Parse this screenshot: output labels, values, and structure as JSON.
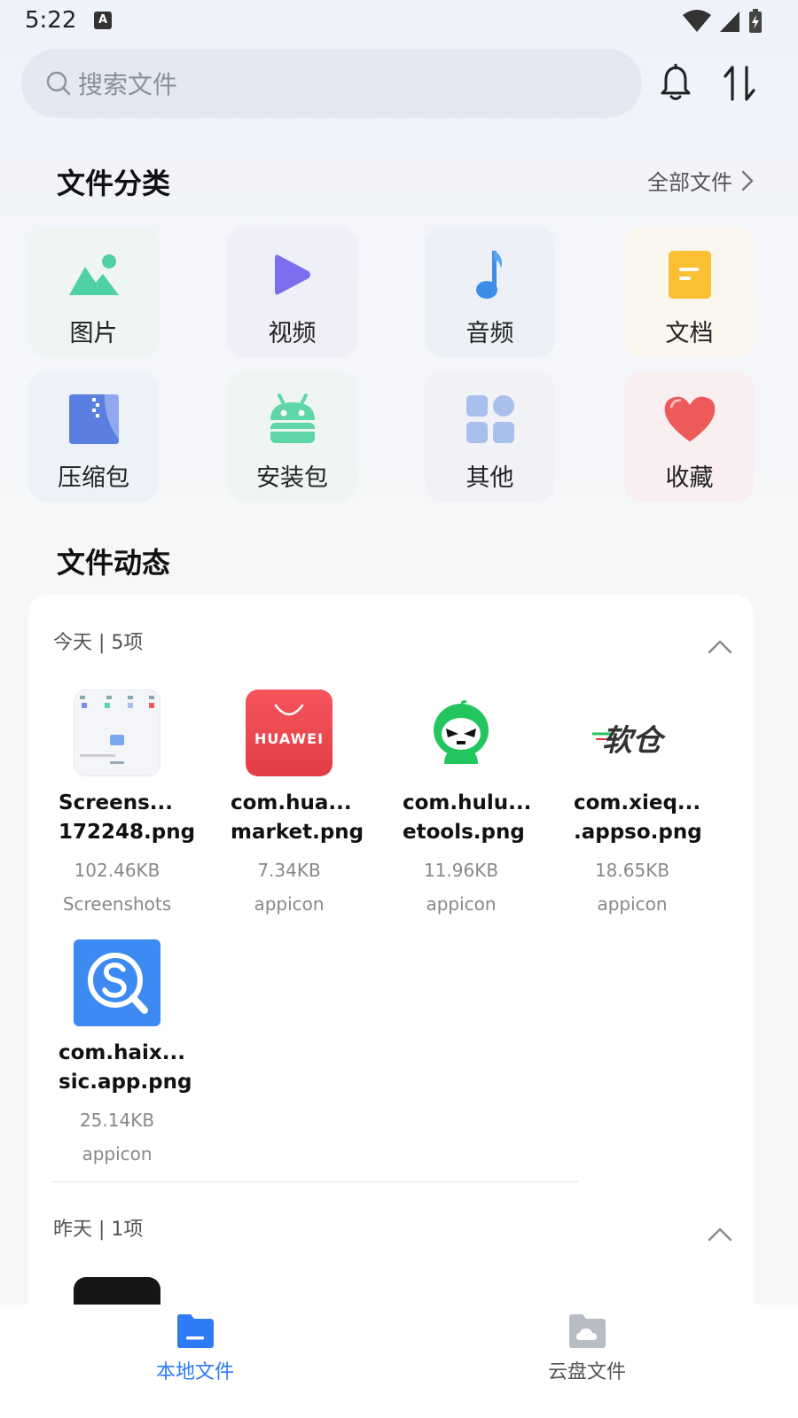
{
  "status_bar": {
    "time": "5:22",
    "a_badge": "A"
  },
  "search": {
    "placeholder": "搜索文件"
  },
  "categories_section": {
    "title": "文件分类",
    "all_files_label": "全部文件",
    "items": [
      {
        "label": "图片",
        "icon": "image-icon",
        "bg": "#eef5f3",
        "color": "#4fd1a5"
      },
      {
        "label": "视频",
        "icon": "video-play-icon",
        "bg": "#eeeff7",
        "color": "#7b6ff0"
      },
      {
        "label": "音频",
        "icon": "music-note-icon",
        "bg": "#edf0f6",
        "color": "#3c8de8"
      },
      {
        "label": "文档",
        "icon": "document-icon",
        "bg": "#faf6ee",
        "color": "#fbbf34"
      },
      {
        "label": "压缩包",
        "icon": "zip-archive-icon",
        "bg": "#edf1f8",
        "color": "#5b7fe0"
      },
      {
        "label": "安装包",
        "icon": "android-package-icon",
        "bg": "#eef5f2",
        "color": "#5fd6a8"
      },
      {
        "label": "其他",
        "icon": "other-grid-icon",
        "bg": "#f0f2f6",
        "color": "#a9c0ec"
      },
      {
        "label": "收藏",
        "icon": "heart-favorite-icon",
        "bg": "#f9eef0",
        "color": "#ee5a5a"
      }
    ]
  },
  "activity_section": {
    "title": "文件动态",
    "groups": [
      {
        "header": "今天 | 5项",
        "files": [
          {
            "name_line1": "Screens...",
            "name_line2": "172248.png",
            "size": "102.46KB",
            "source": "Screenshots",
            "thumb": "screenshot-thumb"
          },
          {
            "name_line1": "com.hua...",
            "name_line2": "market.png",
            "size": "7.34KB",
            "source": "appicon",
            "thumb": "huawei-appicon",
            "thumb_text": "HUAWEI"
          },
          {
            "name_line1": "com.hulu...",
            "name_line2": "etools.png",
            "size": "11.96KB",
            "source": "appicon",
            "thumb": "green-gourd-appicon"
          },
          {
            "name_line1": "com.xieq...",
            "name_line2": ".appso.png",
            "size": "18.65KB",
            "source": "appicon",
            "thumb": "ruancang-appicon",
            "thumb_text": "软仓"
          },
          {
            "name_line1": "com.haix...",
            "name_line2": "sic.app.png",
            "size": "25.14KB",
            "source": "appicon",
            "thumb": "search-s-appicon"
          }
        ]
      },
      {
        "header": "昨天 | 1项"
      }
    ]
  },
  "bottom_nav": {
    "items": [
      {
        "label": "本地文件",
        "active": true
      },
      {
        "label": "云盘文件",
        "active": false
      }
    ]
  },
  "colors": {
    "accent": "#2f7bf5",
    "inactive": "#555555"
  }
}
